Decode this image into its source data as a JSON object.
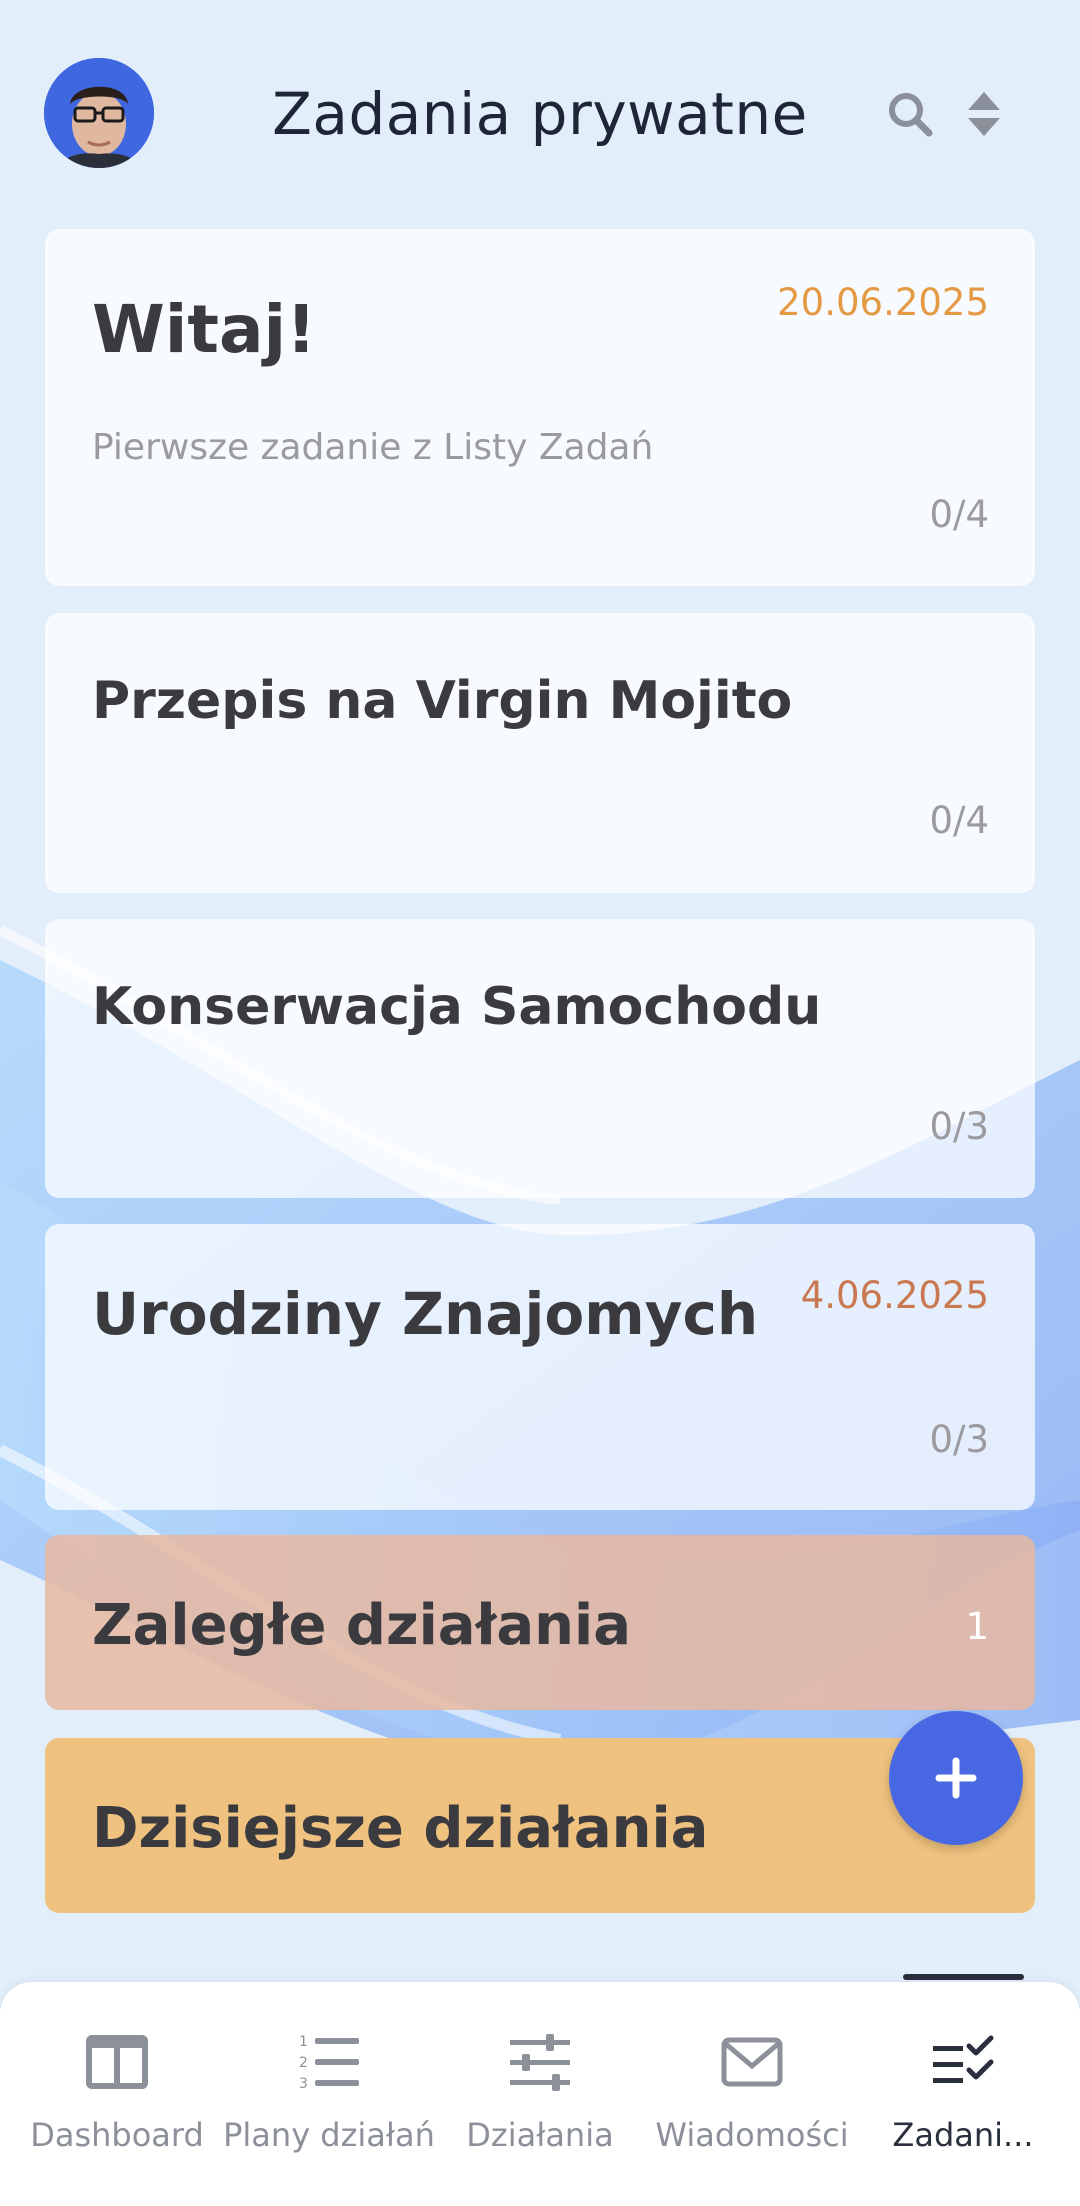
{
  "header": {
    "title": "Zadania prywatne"
  },
  "tasks": [
    {
      "title": "Witaj!",
      "subtitle": "Pierwsze zadanie z Listy Zadań",
      "date": "20.06.2025",
      "progress": "0/4"
    },
    {
      "title": "Przepis na Virgin Mojito",
      "progress": "0/4"
    },
    {
      "title": "Konserwacja Samochodu",
      "progress": "0/3"
    },
    {
      "title": "Urodziny Znajomych",
      "date": "4.06.2025",
      "progress": "0/3"
    }
  ],
  "sections": {
    "overdue": {
      "label": "Zaległe działania",
      "count": "1"
    },
    "today": {
      "label": "Dzisiejsze działania"
    }
  },
  "nav": {
    "items": [
      {
        "label": "Dashboard",
        "icon": "dashboard-icon"
      },
      {
        "label": "Plany działań",
        "icon": "numbered-list-icon"
      },
      {
        "label": "Działania",
        "icon": "sliders-icon"
      },
      {
        "label": "Wiadomości",
        "icon": "envelope-icon"
      },
      {
        "label": "Zadani...",
        "icon": "checklist-icon",
        "active": true
      }
    ]
  },
  "colors": {
    "date_orange": "#e49a44",
    "date_red": "#c9784f",
    "overdue_bg": "#e8c3ad",
    "today_bg": "#efc27f",
    "fab": "#4767e3"
  }
}
